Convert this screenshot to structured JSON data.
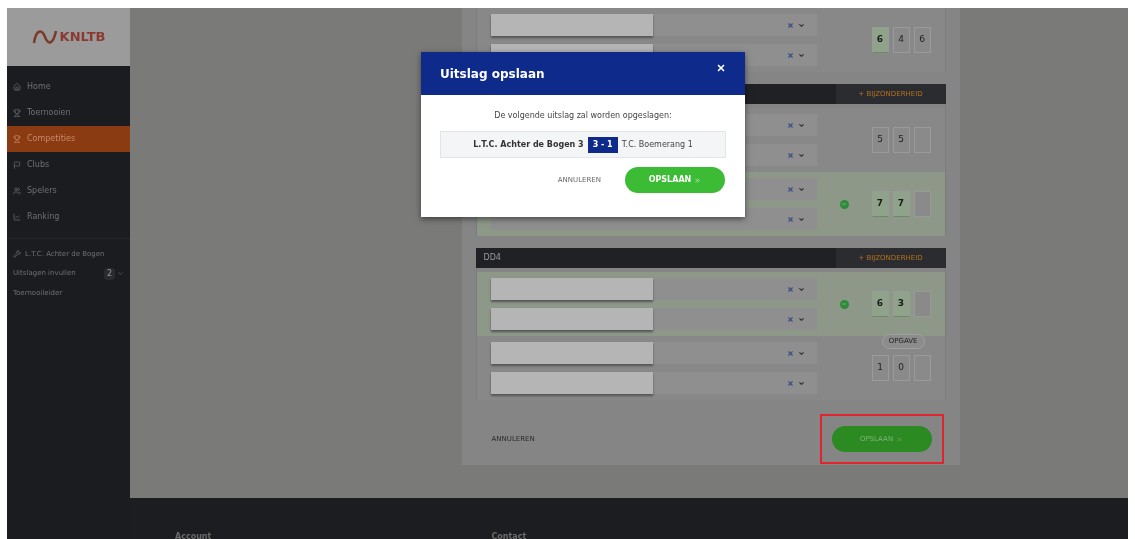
{
  "logo": {
    "text": "KNLTB"
  },
  "nav": [
    {
      "label": "Home",
      "selected": false
    },
    {
      "label": "Toernooien",
      "selected": false
    },
    {
      "label": "Competities",
      "selected": true
    },
    {
      "label": "Clubs",
      "selected": false
    },
    {
      "label": "Spelers",
      "selected": false
    },
    {
      "label": "Ranking",
      "selected": false
    }
  ],
  "club": {
    "label": "L.T.C. Achter de Bogen",
    "links": [
      {
        "label": "Uitslagen invullen",
        "badge": "2"
      },
      {
        "label": "Toernooileider"
      }
    ]
  },
  "matches": [
    {
      "teams": [
        {
          "winner": false,
          "players": [
            {
              "redacted": true
            },
            {
              "redacted": true
            }
          ],
          "scores": [
            {
              "value": "6",
              "won": true
            },
            {
              "value": "4",
              "won": false
            },
            {
              "value": "6",
              "won": false
            }
          ]
        }
      ]
    },
    {
      "action": "+ BIJZONDERHEID",
      "teams": [
        {
          "winner": false,
          "scores": [
            {
              "value": "5",
              "won": false
            },
            {
              "value": "5",
              "won": false
            },
            {
              "won": false
            }
          ]
        },
        {
          "winner": true,
          "scores": [
            {
              "value": "7",
              "won": true
            },
            {
              "value": "7",
              "won": true
            },
            {
              "won": false
            }
          ]
        }
      ]
    },
    {
      "header": "DD4",
      "action": "+ BIJZONDERHEID",
      "retire": "OPGAVE",
      "teams": [
        {
          "winner": true,
          "players": [
            {
              "redacted": true
            },
            {
              "redacted": true
            }
          ],
          "scores": [
            {
              "value": "6",
              "won": true
            },
            {
              "value": "3",
              "won": true
            },
            {
              "won": false
            }
          ]
        },
        {
          "winner": false,
          "players": [
            {
              "redacted": true
            },
            {
              "redacted": true
            }
          ],
          "scores": [
            {
              "value": "1",
              "won": false
            },
            {
              "value": "0",
              "won": false
            },
            {
              "won": false
            }
          ]
        }
      ]
    }
  ],
  "form_buttons": {
    "cancel": "ANNULEREN",
    "save": "OPSLAAN",
    "save_highlighted": true
  },
  "modal": {
    "title": "Uitslag opslaan",
    "message": "De volgende uitslag zal worden opgeslagen:",
    "home": "L.T.C. Achter de Bogen 3",
    "score": "3 - 1",
    "away": "T.C. Boemerang 1",
    "cancel": "ANNULEREN",
    "save": "OPSLAAN"
  },
  "footer": [
    "Account",
    "Contact"
  ]
}
